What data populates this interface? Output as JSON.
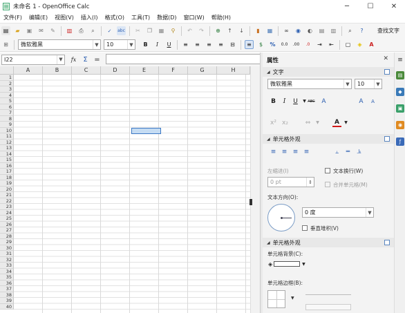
{
  "window": {
    "title": "未命名 1 - OpenOffice Calc",
    "minimize": "─",
    "maximize": "☐",
    "close": "✕"
  },
  "menubar": [
    "文件(F)",
    "编辑(E)",
    "视图(V)",
    "插入(I)",
    "格式(O)",
    "工具(T)",
    "数据(D)",
    "窗口(W)",
    "帮助(H)"
  ],
  "toolbar": {
    "find_text": "查找文字"
  },
  "format_bar": {
    "font_name": "微软雅黑",
    "font_size": "10"
  },
  "formula_bar": {
    "name_box": "I22",
    "func_wizard": "fx",
    "sum": "Σ",
    "equals": "=",
    "content": ""
  },
  "sheet": {
    "columns": [
      "A",
      "B",
      "C",
      "D",
      "E",
      "F",
      "G",
      "H"
    ],
    "rows": [
      "1",
      "2",
      "3",
      "4",
      "5",
      "6",
      "7",
      "8",
      "9",
      "10",
      "11",
      "12",
      "13",
      "14",
      "15",
      "16",
      "17",
      "18",
      "19",
      "20",
      "21",
      "22",
      "23",
      "24",
      "25",
      "26",
      "27",
      "28",
      "29",
      "30",
      "31",
      "32",
      "33",
      "34",
      "35",
      "36",
      "37",
      "38",
      "39",
      "40"
    ],
    "selected_cell": "E10"
  },
  "sidebar": {
    "title": "属性",
    "close": "✕",
    "text_panel": {
      "title": "文字",
      "font_name": "微软雅黑",
      "font_size": "10"
    },
    "cell_appearance_panel": {
      "title": "单元格外观",
      "indent_label": "左缩进(I)",
      "indent_value": "0 pt",
      "wrap_text": "文本换行(W)",
      "merge_cells": "合并单元格(M)",
      "text_orientation": "文本方向(O):",
      "angle_value": "0 度",
      "stacked": "垂直堆积(V)"
    },
    "cell_appearance_panel2": {
      "title": "单元格外观",
      "background_label": "单元格背景(C):",
      "border_label": "单元格边框(B):"
    }
  },
  "colors": {
    "selection_fill": "#c5dcf3",
    "selection_border": "#3b78c4",
    "font_color_bar": "#d01818"
  }
}
